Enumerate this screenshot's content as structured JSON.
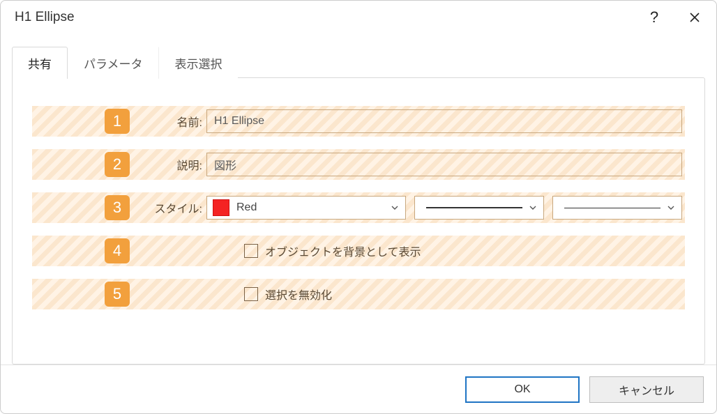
{
  "window": {
    "title": "H1 Ellipse"
  },
  "tabs": {
    "common": "共有",
    "parameters": "パラメータ",
    "display": "表示選択"
  },
  "rows": {
    "r1": {
      "num": "1",
      "label": "名前:",
      "value": "H1 Ellipse"
    },
    "r2": {
      "num": "2",
      "label": "説明:",
      "value": "図形"
    },
    "r3": {
      "num": "3",
      "label": "スタイル:",
      "color_name": "Red",
      "color_hex": "#f42323"
    },
    "r4": {
      "num": "4",
      "label": "オブジェクトを背景として表示"
    },
    "r5": {
      "num": "5",
      "label": "選択を無効化"
    }
  },
  "footer": {
    "ok": "OK",
    "cancel": "キャンセル"
  }
}
